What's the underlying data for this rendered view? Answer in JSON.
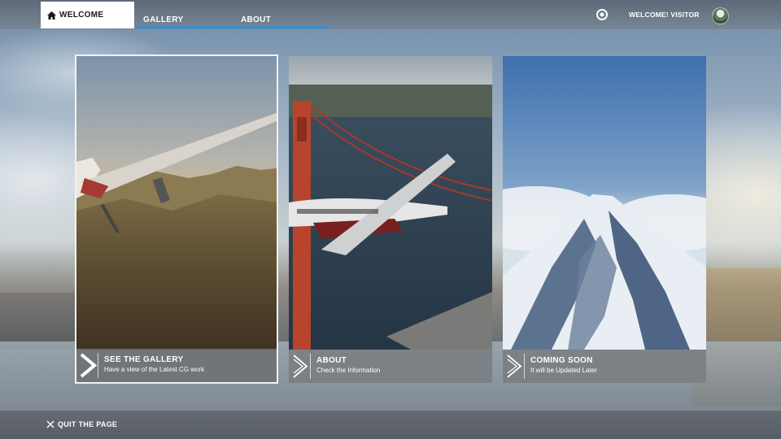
{
  "nav": {
    "tabs": [
      {
        "label": "WELCOME",
        "icon": "home-icon",
        "active": true
      },
      {
        "label": "GALLERY",
        "active": false
      },
      {
        "label": "ABOUT",
        "active": false
      }
    ],
    "greeting": "WELCOME! VISITOR",
    "settings_icon": "gear-icon"
  },
  "cards": [
    {
      "title": "SEE THE GALLERY",
      "subtitle": "Have a view of the Latest CG work",
      "icon": "chevron-right-icon"
    },
    {
      "title": "ABOUT",
      "subtitle": "Check the Information",
      "icon": "chevron-right-icon"
    },
    {
      "title": "COMING SOON",
      "subtitle": "It will be Updated Later",
      "icon": "chevron-right-icon"
    }
  ],
  "footer": {
    "quit_label": "QUIT THE PAGE",
    "quit_icon": "close-icon"
  },
  "colors": {
    "accent": "#2f8fd8",
    "active_tab_bg": "#ffffff"
  }
}
